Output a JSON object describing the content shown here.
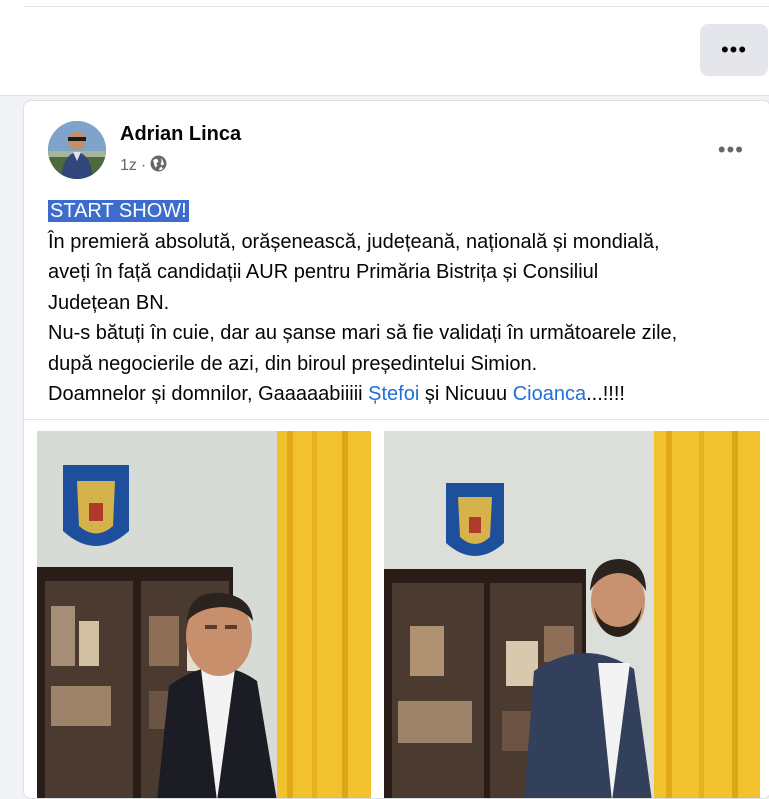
{
  "topbar": {
    "more_icon": "more-horizontal-icon"
  },
  "post": {
    "author": "Adrian Linca",
    "time": "1z",
    "separator": "·",
    "privacy_icon": "globe-icon",
    "more_icon": "more-horizontal-icon",
    "body": {
      "line1": "START SHOW!",
      "line2": "În premieră absolută, orășenească, județeană, națională și mondială,",
      "line3": "aveți în față candidații AUR pentru Primăria Bistrița și Consiliul",
      "line4": "Județean BN.",
      "line5": "Nu-s bătuți în cuie, dar au șanse mari să fie validați în următoarele zile,",
      "line6": "după negocierile de azi, din biroul președintelui Simion.",
      "line7_prefix": "Doamnelor și domnilor, Gaaaaabiiiii ",
      "mention1": "Ștefoi",
      "line7_middle": " și Nicuuu ",
      "mention2": "Cioanca",
      "line7_suffix": "...!!!!"
    },
    "images": [
      {
        "subject": "man in dark suit in front of bookshelf and yellow curtain"
      },
      {
        "subject": "man with beard in grey suit in front of bookshelf and yellow curtain"
      }
    ]
  },
  "colors": {
    "background": "#f0f2f5",
    "card": "#ffffff",
    "highlight": "#3c6dcc",
    "mention": "#216fdb",
    "secondary_text": "#65676b"
  }
}
